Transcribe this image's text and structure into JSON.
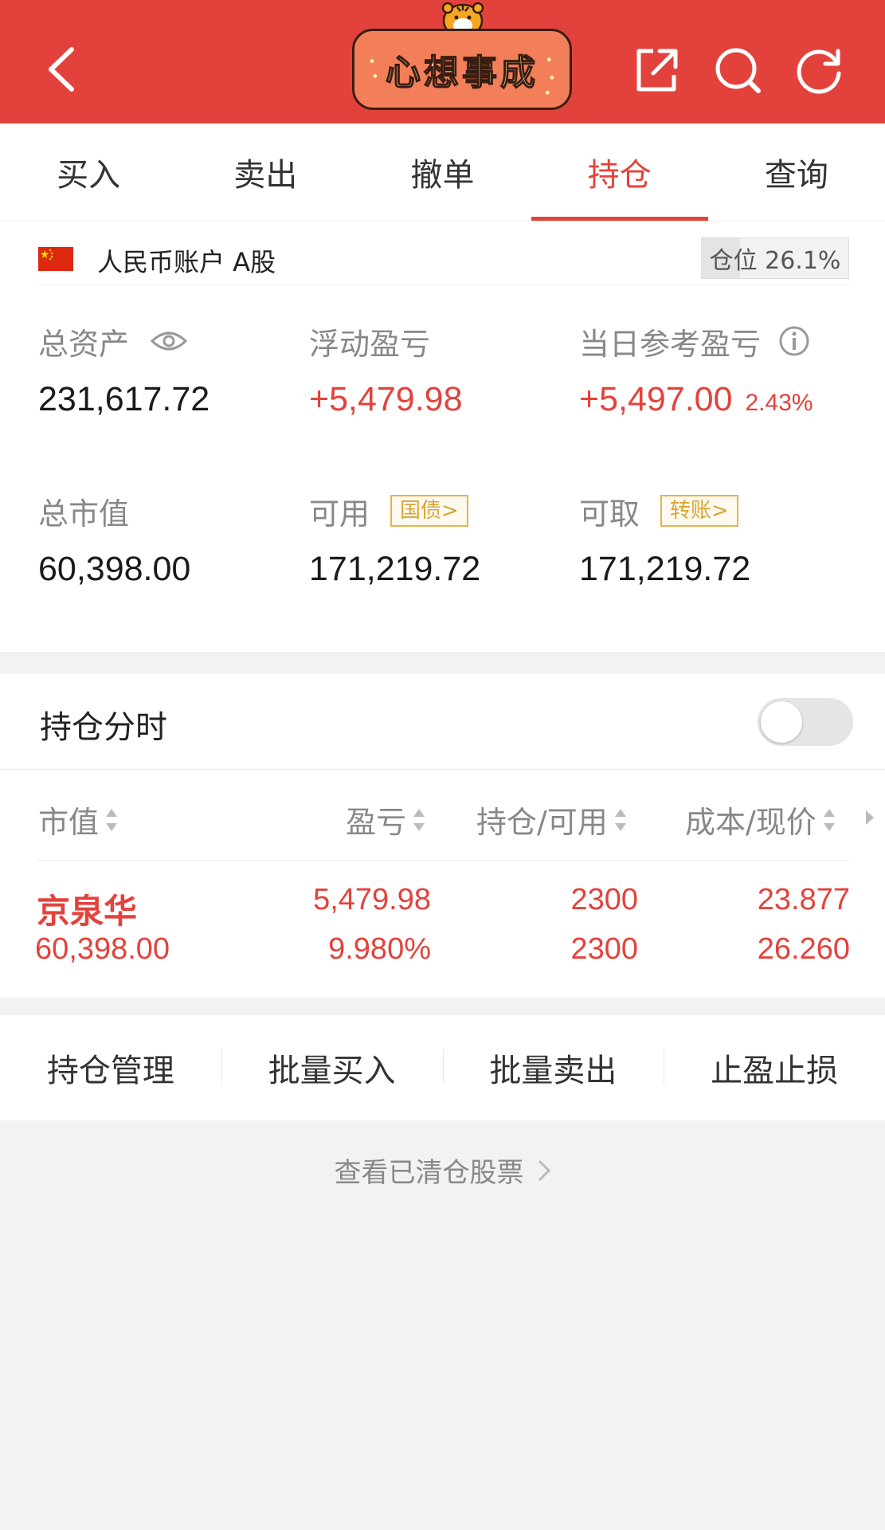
{
  "header": {
    "banner_text": "心想事成",
    "accent_color": "#e3423c",
    "icons": [
      "back-icon",
      "share-icon",
      "search-icon",
      "refresh-icon"
    ]
  },
  "tabs": [
    {
      "label": "买入",
      "active": false
    },
    {
      "label": "卖出",
      "active": false
    },
    {
      "label": "撤单",
      "active": false
    },
    {
      "label": "持仓",
      "active": true
    },
    {
      "label": "查询",
      "active": false
    }
  ],
  "account": {
    "name": "人民币账户 A股",
    "position_label": "仓位 26.1%",
    "position_ratio": 0.261
  },
  "metrics": {
    "total_assets": {
      "label": "总资产",
      "value": "231,617.72"
    },
    "floating_pnl": {
      "label": "浮动盈亏",
      "value": "+5,479.98"
    },
    "today_pnl": {
      "label": "当日参考盈亏",
      "value": "+5,497.00",
      "pct": "2.43%"
    },
    "market_value": {
      "label": "总市值",
      "value": "60,398.00"
    },
    "available": {
      "label": "可用",
      "tag": "国债>",
      "value": "171,219.72"
    },
    "withdrawable": {
      "label": "可取",
      "tag": "转账>",
      "value": "171,219.72"
    }
  },
  "holdings": {
    "title": "持仓分时",
    "toggle_on": false,
    "columns": [
      "市值",
      "盈亏",
      "持仓/可用",
      "成本/现价"
    ],
    "rows": [
      {
        "name": "京泉华",
        "market_value": "60,398.00",
        "pnl": "5,479.98",
        "pnl_pct": "9.980%",
        "position": "2300",
        "available": "2300",
        "cost": "23.877",
        "price": "26.260"
      }
    ]
  },
  "actions": [
    "持仓管理",
    "批量买入",
    "批量卖出",
    "止盈止损"
  ],
  "cleared_link": "查看已清仓股票"
}
